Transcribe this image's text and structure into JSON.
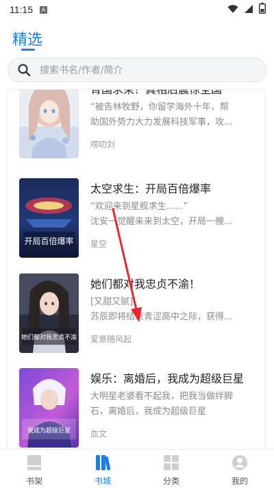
{
  "status_bar": {
    "time": "11:15",
    "notification_badge": "A"
  },
  "header": {
    "title": "精选"
  },
  "search": {
    "placeholder": "搜索书名/作者/简介"
  },
  "books": [
    {
      "title": "背国求荣？真相后震惊全国",
      "desc_line1": "“被告林牧野，你留学海外十年，帮",
      "desc_line2": "助国外势力大力发展科技军事，攻...",
      "author": "唠叨刘",
      "cover_icon": "anime-girl-cover"
    },
    {
      "title": "太空求生：开局百倍爆率",
      "desc_line1": "“欢迎来到星舰求生......”",
      "desc_line2": "沈安一觉醒来来到太空，开局一艘...",
      "author": "星空",
      "cover_icon": "space-cover",
      "cover_text": "开局百倍爆率"
    },
    {
      "title": "她们都对我忠贞不渝！",
      "desc_line1": "[又甜又腻]",
      "desc_line2": "苏辰即将结束青涩高中之际，获得...",
      "author": "爱意随风起",
      "cover_icon": "girl-portrait-cover",
      "cover_text": "她们都对我忠贞不渝"
    },
    {
      "title": "娱乐：离婚后，我成为超级巨星",
      "desc_line1": "大明星老婆看不起我，把我当做绊脚",
      "desc_line2": "石，离婚后，我成为超级巨星",
      "author": "血文",
      "cover_icon": "singer-cover",
      "cover_text": "我成为超级巨星"
    }
  ],
  "tabs": [
    {
      "label": "书架",
      "icon": "bookshelf-icon",
      "active": false
    },
    {
      "label": "书城",
      "icon": "bookstore-icon",
      "active": true
    },
    {
      "label": "分类",
      "icon": "category-icon",
      "active": false
    },
    {
      "label": "我的",
      "icon": "profile-icon",
      "active": false
    }
  ],
  "colors": {
    "accent": "#1f7fe0",
    "annotation_arrow": "#e8262e",
    "tab_inactive": "#cfcfcf"
  }
}
